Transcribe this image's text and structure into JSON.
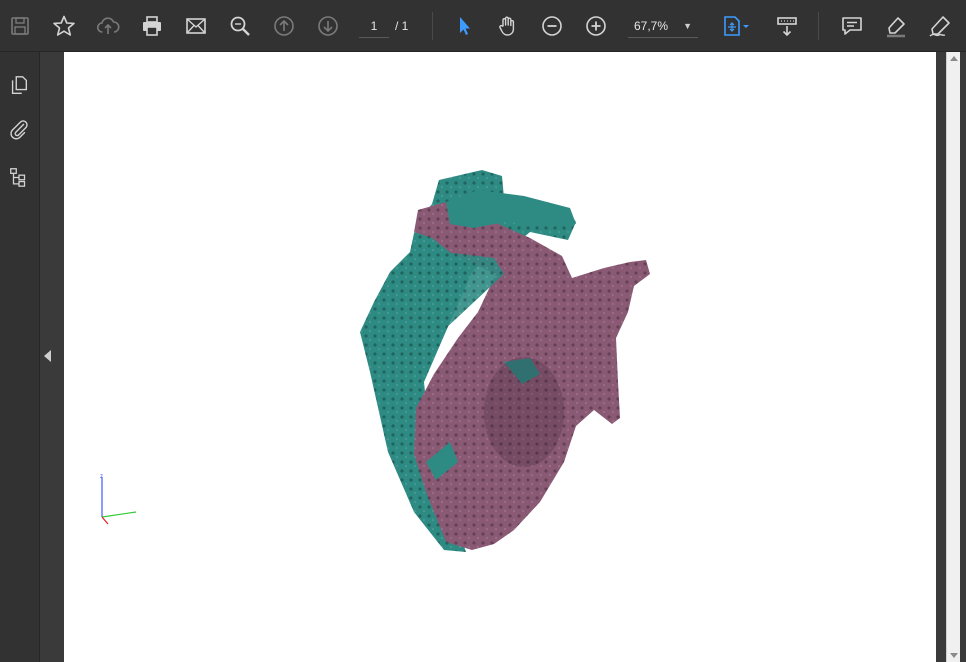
{
  "toolbar": {
    "page_current": "1",
    "page_total": "/ 1",
    "zoom_level": "67,7%",
    "icons": [
      "save-icon",
      "bookmark-star-icon",
      "upload-cloud-icon",
      "print-icon",
      "email-icon",
      "find-icon",
      "page-up-icon",
      "page-down-icon",
      "select-cursor-icon",
      "hand-tool-icon",
      "zoom-out-icon",
      "zoom-in-icon",
      "fit-page-icon",
      "scroll-mode-icon",
      "comment-icon",
      "highlight-icon",
      "sign-icon"
    ]
  },
  "sidebar": {
    "icons": [
      "page-thumbnails-icon",
      "attachments-icon",
      "layers-icon"
    ]
  },
  "viewer": {
    "model_colors": {
      "teal": "#2e8b84",
      "purple": "#8a5a75"
    },
    "axis_labels": {
      "z": "z"
    }
  },
  "colors": {
    "toolbar_bg": "#323232",
    "accent": "#3d9bff"
  }
}
